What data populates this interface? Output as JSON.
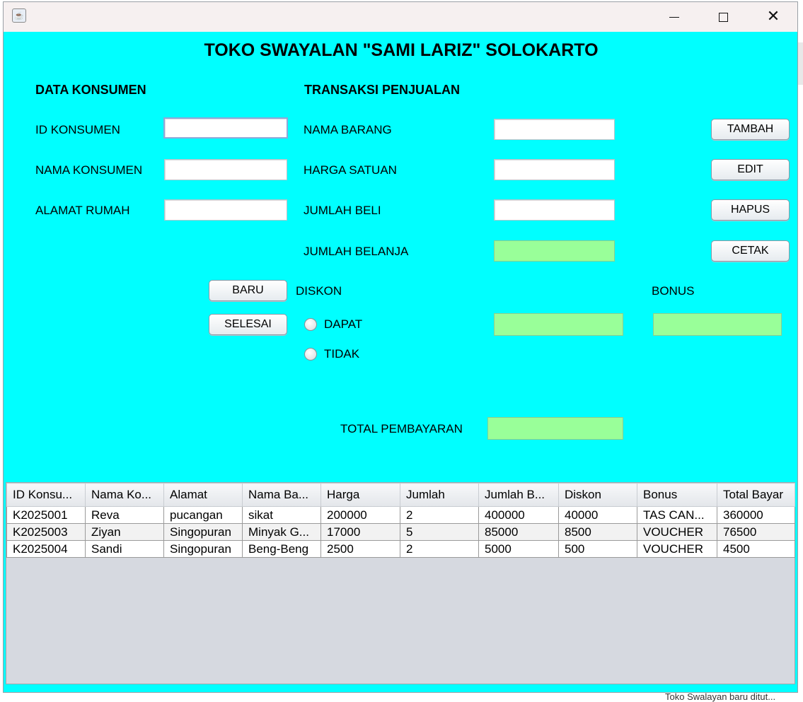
{
  "window": {
    "title": "",
    "app_icon": "java-cup-icon",
    "controls": {
      "minimize": "minimize-icon",
      "maximize": "maximize-icon",
      "close": "close-icon"
    }
  },
  "colors": {
    "background": "#00ffff",
    "output_field": "#99ff99",
    "table_bg": "#d6d9e0"
  },
  "header": {
    "title": "TOKO SWAYALAN \"SAMI LARIZ\" SOLOKARTO"
  },
  "konsumen": {
    "heading": "DATA KONSUMEN",
    "id_label": "ID KONSUMEN",
    "id_value": "",
    "nama_label": "NAMA KONSUMEN",
    "nama_value": "",
    "alamat_label": "ALAMAT RUMAH",
    "alamat_value": ""
  },
  "transaksi": {
    "heading": "TRANSAKSI PENJUALAN",
    "nama_barang_label": "NAMA BARANG",
    "nama_barang_value": "",
    "harga_label": "HARGA SATUAN",
    "harga_value": "",
    "jumlah_beli_label": "JUMLAH BELI",
    "jumlah_beli_value": "",
    "jumlah_belanja_label": "JUMLAH BELANJA",
    "jumlah_belanja_value": ""
  },
  "buttons": {
    "tambah": "TAMBAH",
    "edit": "EDIT",
    "hapus": "HAPUS",
    "cetak": "CETAK",
    "baru": "BARU",
    "selesai": "SELESAI"
  },
  "diskon": {
    "label": "DISKON",
    "option_dapat": "DAPAT",
    "option_tidak": "TIDAK",
    "value": ""
  },
  "bonus": {
    "label": "BONUS",
    "value": ""
  },
  "total": {
    "label": "TOTAL PEMBAYARAN",
    "value": ""
  },
  "table": {
    "columns": [
      "ID Konsu...",
      "Nama Ko...",
      "Alamat",
      "Nama Ba...",
      "Harga",
      "Jumlah",
      "Jumlah B...",
      "Diskon",
      "Bonus",
      "Total Bayar"
    ],
    "rows": [
      [
        "K2025001",
        "Reva",
        "pucangan",
        "sikat",
        "200000",
        "2",
        "400000",
        "40000",
        "TAS CAN...",
        "360000"
      ],
      [
        "K2025003",
        "Ziyan",
        "Singopuran",
        "Minyak G...",
        "17000",
        "5",
        "85000",
        "8500",
        "VOUCHER",
        "76500"
      ],
      [
        "K2025004",
        "Sandi",
        "Singopuran",
        "Beng-Beng",
        "2500",
        "2",
        "5000",
        "500",
        "VOUCHER",
        "4500"
      ]
    ]
  },
  "status": {
    "text": "Toko Swalayan baru ditut..."
  }
}
